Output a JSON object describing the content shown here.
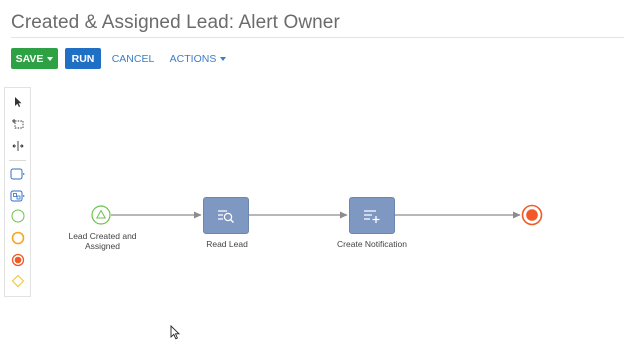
{
  "page": {
    "title": "Created & Assigned Lead: Alert Owner"
  },
  "toolbar": {
    "save_label": "SAVE",
    "run_label": "RUN",
    "cancel_label": "CANCEL",
    "actions_label": "ACTIONS"
  },
  "palette": {
    "items": [
      {
        "name": "pointer-tool",
        "icon": "arrow-pointer-icon"
      },
      {
        "name": "lasso-tool",
        "icon": "lasso-select-icon"
      },
      {
        "name": "space-tool",
        "icon": "space-tool-icon"
      },
      {
        "name": "task-element",
        "icon": "task-rectangle-icon"
      },
      {
        "name": "subprocess-element",
        "icon": "subprocess-icon"
      },
      {
        "name": "start-event",
        "icon": "start-event-circle-icon"
      },
      {
        "name": "intermediate-event",
        "icon": "intermediate-event-circle-icon"
      },
      {
        "name": "end-event",
        "icon": "end-event-circle-icon"
      },
      {
        "name": "gateway",
        "icon": "gateway-diamond-icon"
      }
    ]
  },
  "diagram": {
    "start_label": "Lead Created and Assigned",
    "read_label": "Read Lead",
    "notify_label": "Create Notification"
  },
  "colors": {
    "save": "#2ea144",
    "run": "#1f6fc5",
    "link": "#3c7ec4",
    "task": "#7f98c1",
    "start": "#6cc24a",
    "intermediate": "#f5a623",
    "end": "#f05a28",
    "gateway": "#f5c842"
  }
}
